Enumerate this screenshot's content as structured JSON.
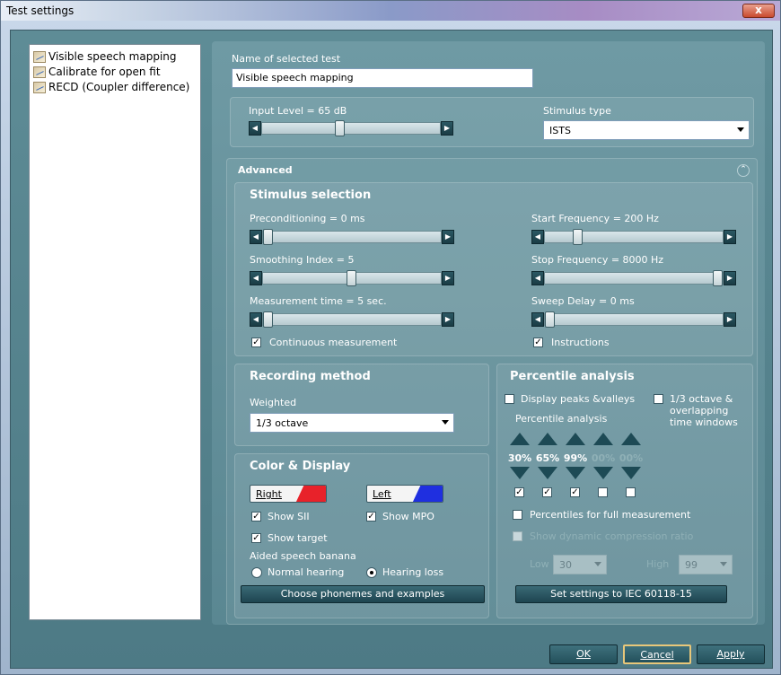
{
  "window": {
    "title": "Test settings",
    "close_label": "x"
  },
  "test_list": [
    {
      "label": "Visible speech mapping"
    },
    {
      "label": "Calibrate for open fit"
    },
    {
      "label": "RECD (Coupler difference)"
    }
  ],
  "name_section": {
    "label": "Name of selected test",
    "value": "Visible speech mapping"
  },
  "input_level": {
    "label": "Input Level = 65 dB",
    "position": 0.43
  },
  "stimulus_type": {
    "label": "Stimulus type",
    "value": "ISTS"
  },
  "advanced": {
    "label": "Advanced",
    "collapse_icon": "chevron-up-icon"
  },
  "stimulus_selection": {
    "title": "Stimulus selection",
    "preconditioning": {
      "label": "Preconditioning = 0 ms",
      "position": 0.0
    },
    "smoothing_index": {
      "label": "Smoothing Index = 5",
      "position": 0.5
    },
    "measurement_time": {
      "label": "Measurement time = 5 sec.",
      "position": 0.0
    },
    "start_frequency": {
      "label": "Start Frequency = 200 Hz",
      "position": 0.18
    },
    "stop_frequency": {
      "label": "Stop Frequency = 8000 Hz",
      "position": 1.0
    },
    "sweep_delay": {
      "label": "Sweep Delay = 0 ms",
      "position": 0.0
    },
    "continuous_measurement": {
      "label": "Continuous measurement",
      "checked": "✓"
    },
    "instructions": {
      "label": "Instructions",
      "checked": "✓"
    }
  },
  "recording_method": {
    "title": "Recording method",
    "weighted_label": "Weighted",
    "weighted_value": "1/3 octave"
  },
  "color_display": {
    "title": "Color & Display",
    "right_label": "Right",
    "right_color": "#e8222a",
    "left_label": "Left",
    "left_color": "#1f2fe0",
    "show_sii": "Show SII",
    "show_mpo": "Show MPO",
    "show_target": "Show target",
    "check_mark": "✓",
    "aided_banana": "Aided speech banana",
    "normal_hearing": "Normal hearing",
    "hearing_loss": "Hearing loss",
    "choose_phonemes": "Choose phonemes and examples"
  },
  "percentile": {
    "title": "Percentile analysis",
    "display_peaks": "Display peaks &valleys",
    "octave_windows": "1/3 octave & overlapping time windows",
    "sub_label": "Percentile analysis",
    "values": [
      "30%",
      "65%",
      "99%",
      "00%",
      "00%"
    ],
    "check_mark": "✓",
    "full_measurement": "Percentiles for full measurement",
    "dynamic_compression": "Show dynamic compression ratio",
    "low_label": "Low",
    "low_value": "30",
    "high_label": "High",
    "high_value": "99",
    "iec_button": "Set settings to IEC 60118-15"
  },
  "footer": {
    "ok": "OK",
    "cancel": "Cancel",
    "apply": "Apply"
  }
}
